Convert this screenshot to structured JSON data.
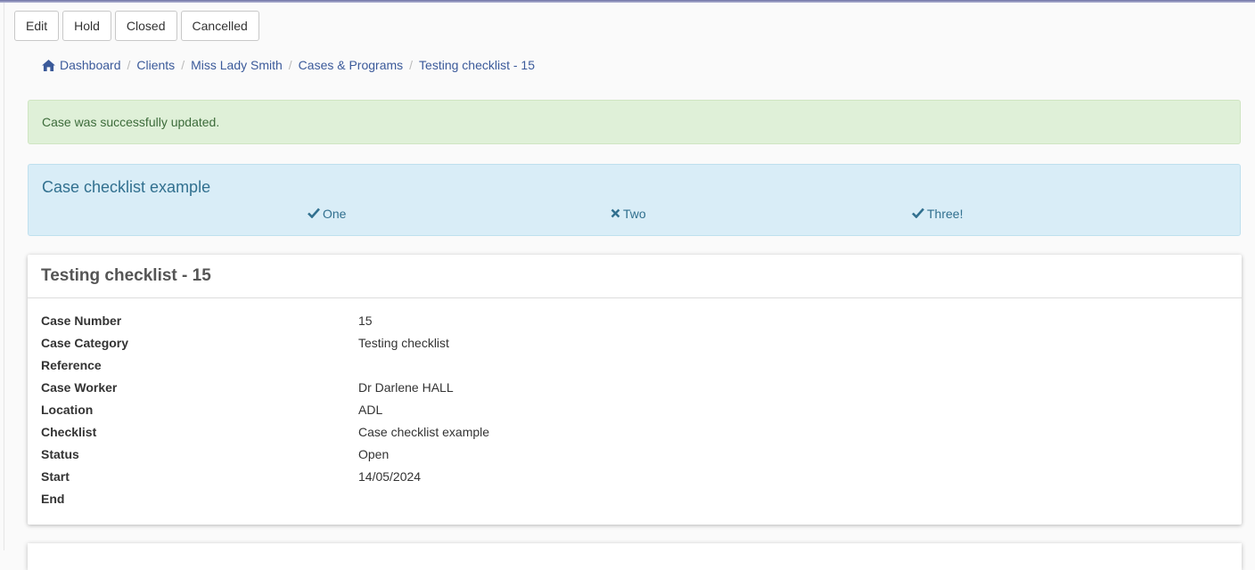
{
  "toolbar": {
    "buttons": [
      "Edit",
      "Hold",
      "Closed",
      "Cancelled"
    ]
  },
  "breadcrumb": {
    "items": [
      "Dashboard",
      "Clients",
      "Miss Lady Smith",
      "Cases & Programs",
      "Testing checklist - 15"
    ],
    "separator": "/",
    "home_icon": "home-icon"
  },
  "alert": {
    "message": "Case was successfully updated."
  },
  "checklist": {
    "title": "Case checklist example",
    "items": [
      {
        "label": "One",
        "status": "checked",
        "icon": "check-icon"
      },
      {
        "label": "Two",
        "status": "unchecked",
        "icon": "cross-icon"
      },
      {
        "label": "Three!",
        "status": "checked",
        "icon": "check-icon"
      }
    ]
  },
  "case": {
    "title": "Testing checklist - 15",
    "fields": [
      {
        "label": "Case Number",
        "value": "15"
      },
      {
        "label": "Case Category",
        "value": "Testing checklist"
      },
      {
        "label": "Reference",
        "value": ""
      },
      {
        "label": "Case Worker",
        "value": "Dr Darlene HALL"
      },
      {
        "label": "Location",
        "value": "ADL"
      },
      {
        "label": "Checklist",
        "value": "Case checklist example"
      },
      {
        "label": "Status",
        "value": "Open"
      },
      {
        "label": "Start",
        "value": "14/05/2024"
      },
      {
        "label": "End",
        "value": ""
      }
    ]
  },
  "colors": {
    "link": "#3b5a9a",
    "success_bg": "#dff0d8",
    "info_bg": "#d9edf7",
    "info_text": "#31708f"
  }
}
